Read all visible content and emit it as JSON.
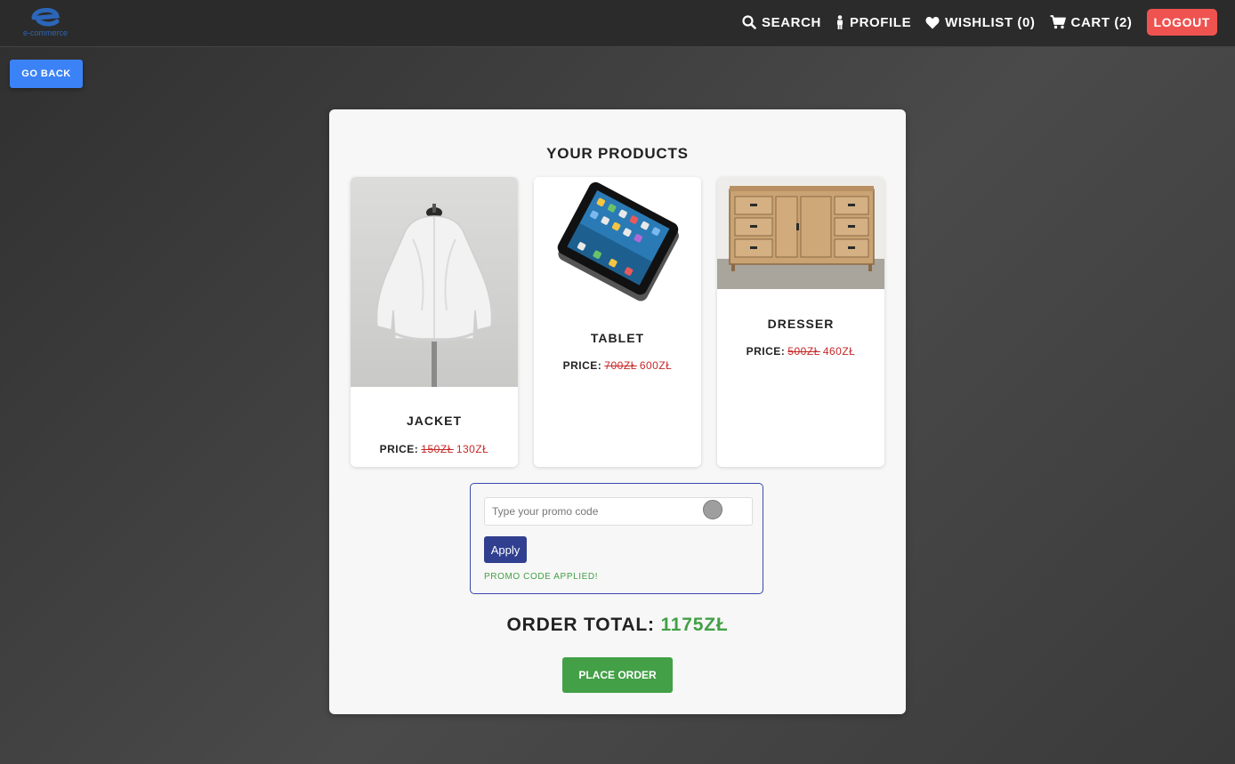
{
  "navbar": {
    "logo_text": "e-commerce",
    "links": [
      {
        "label": "SEARCH",
        "icon": "search-icon"
      },
      {
        "label": "PROFILE",
        "icon": "person-icon"
      },
      {
        "label": "WISHLIST (0)",
        "icon": "heart-icon"
      },
      {
        "label": "CART (2)",
        "icon": "cart-icon"
      }
    ],
    "logout_label": "LOGOUT"
  },
  "go_back_label": "GO BACK",
  "products_title": "YOUR PRODUCTS",
  "products": [
    {
      "name": "JACKET",
      "price_label": "PRICE:",
      "old_price": "150ZŁ",
      "new_price": "130ZŁ",
      "image": "white-jacket-image"
    },
    {
      "name": "TABLET",
      "price_label": "PRICE:",
      "old_price": "700ZŁ",
      "new_price": "600ZŁ",
      "image": "tablet-image"
    },
    {
      "name": "DRESSER",
      "price_label": "PRICE:",
      "old_price": "500ZŁ",
      "new_price": "460ZŁ",
      "image": "dresser-image"
    }
  ],
  "promo": {
    "placeholder": "Type your promo code",
    "value": "",
    "apply_label": "Apply",
    "message": "PROMO CODE APPLIED!"
  },
  "order_total": {
    "label": "ORDER TOTAL:",
    "value": "1175ZŁ"
  },
  "place_order_label": "PLACE ORDER",
  "colors": {
    "go_back": "#3b82f6",
    "logout": "#ef5350",
    "apply": "#303f8f",
    "success": "#43a047",
    "price_red": "#c62828"
  }
}
